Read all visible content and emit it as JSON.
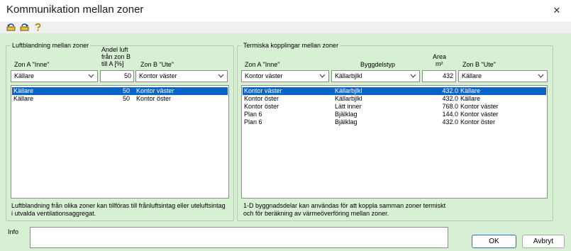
{
  "window": {
    "title": "Kommunikation mellan zoner",
    "close_glyph": "✕"
  },
  "toolbar": {
    "icons": [
      "undo-icon",
      "redo-icon",
      "help-icon"
    ]
  },
  "left": {
    "group_title": "Luftblandning mellan zoner",
    "col_zone_a": "Zon A \"Inne\"",
    "col_share_line1": "Andel luft",
    "col_share_line2": "från zon B",
    "col_share_line3": "till A    [%]",
    "col_zone_b": "Zon B \"Ute\"",
    "zone_a_value": "Källare",
    "share_value": "50",
    "zone_b_value": "Kontor väster",
    "rows": [
      {
        "zone_a": "Källare",
        "share": "50",
        "zone_b": "Kontor väster",
        "selected": true
      },
      {
        "zone_a": "Källare",
        "share": "50",
        "zone_b": "Kontor öster",
        "selected": false
      }
    ],
    "note_line1": "Luftblandning från olika zoner kan tillföras till frånluftsintag eller uteluftsintag",
    "note_line2": "i utvalda ventilationsaggregat."
  },
  "right": {
    "group_title": "Termiska kopplingar mellan zoner",
    "col_zone_a": "Zon A \"Inne\"",
    "col_part": "Byggdelstyp",
    "col_area_line1": "Area",
    "col_area_line2": "m²",
    "col_zone_b": "Zon B \"Ute\"",
    "zone_a_value": "Kontor väster",
    "part_value": "Källarbjlkl",
    "area_value": "432",
    "zone_b_value": "Källare",
    "rows": [
      {
        "zone_a": "Kontor väster",
        "part": "Källarbjlkl",
        "area": "432.0",
        "zone_b": "Källare",
        "selected": true
      },
      {
        "zone_a": "Kontor öster",
        "part": "Källarbjlkl",
        "area": "432.0",
        "zone_b": "Källare",
        "selected": false
      },
      {
        "zone_a": "Kontor öster",
        "part": "Lätt inner",
        "area": "768.0",
        "zone_b": "Kontor väster",
        "selected": false
      },
      {
        "zone_a": "Plan 6",
        "part": "Bjälklag",
        "area": "144.0",
        "zone_b": "Kontor väster",
        "selected": false
      },
      {
        "zone_a": "Plan 6",
        "part": "Bjälklag",
        "area": "432.0",
        "zone_b": "Kontor öster",
        "selected": false
      }
    ],
    "note_line1": "1-D byggnadsdelar kan användas för att koppla samman zoner termiskt",
    "note_line2": "och för beräkning av värmeöverföring mellan zoner."
  },
  "info": {
    "label": "Info",
    "value": ""
  },
  "buttons": {
    "ok": "OK",
    "cancel": "Avbryt"
  },
  "colors": {
    "client_bg": "#d7efd3",
    "selection": "#0a64c8",
    "default_border": "#2f6fc1"
  }
}
